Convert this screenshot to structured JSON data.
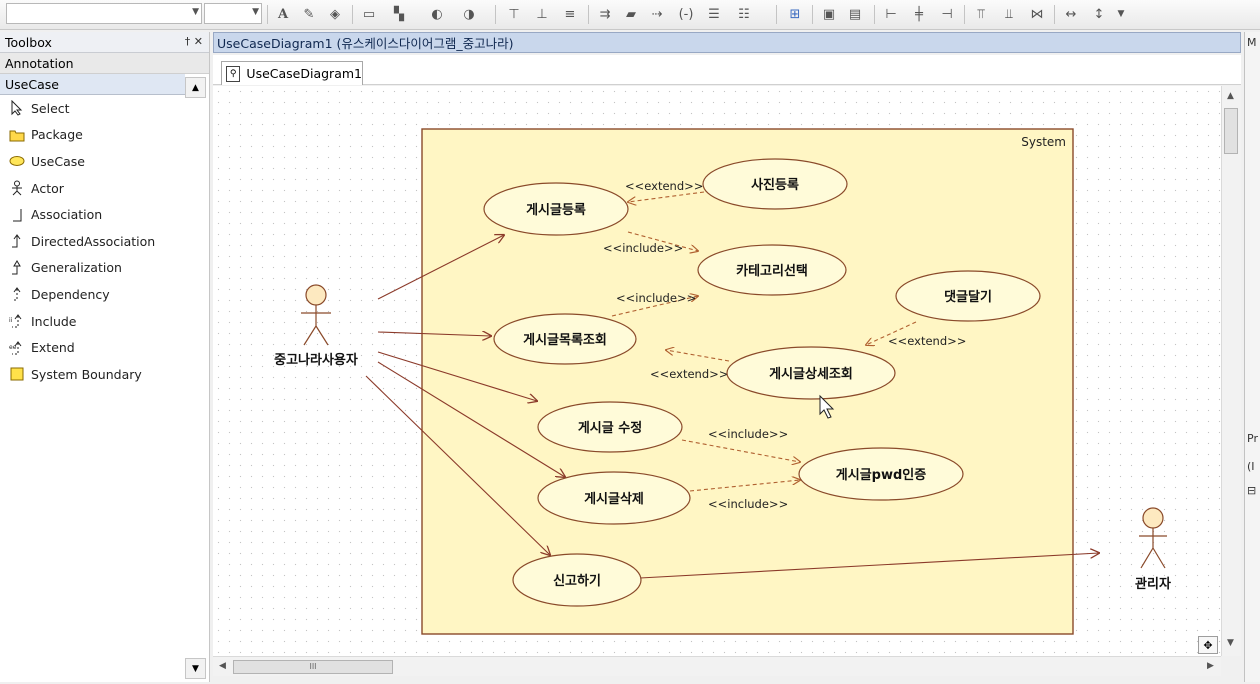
{
  "toolbox": {
    "title": "Toolbox",
    "header_icons": "† ✕",
    "sections": [
      "Annotation",
      "UseCase"
    ],
    "items": [
      {
        "label": "Select",
        "icon": "pointer-icon"
      },
      {
        "label": "Package",
        "icon": "folder-icon"
      },
      {
        "label": "UseCase",
        "icon": "ellipse-icon"
      },
      {
        "label": "Actor",
        "icon": "actor-icon"
      },
      {
        "label": "Association",
        "icon": "association-icon"
      },
      {
        "label": "DirectedAssociation",
        "icon": "directed-association-icon"
      },
      {
        "label": "Generalization",
        "icon": "generalization-icon"
      },
      {
        "label": "Dependency",
        "icon": "dependency-icon"
      },
      {
        "label": "Include",
        "icon": "include-icon"
      },
      {
        "label": "Extend",
        "icon": "extend-icon"
      },
      {
        "label": "System Boundary",
        "icon": "system-boundary-icon"
      }
    ]
  },
  "document": {
    "title": "UseCaseDiagram1 (유스케이스다이어그램_중고나라)",
    "tab_label": "UseCaseDiagram1",
    "scroll_thumb_label": "III"
  },
  "right_panel": {
    "top_label": "M",
    "labels": [
      "Pr",
      "(I",
      "⊟"
    ]
  },
  "diagram": {
    "system_label": "System",
    "use_cases": {
      "post_register": "게시글등록",
      "photo_register": "사진등록",
      "category_select": "카테고리선택",
      "comment": "댓글달기",
      "post_list": "게시글목록조회",
      "post_detail": "게시글상세조회",
      "post_edit": "게시글 수정",
      "post_delete": "게시글삭제",
      "pwd_auth": "게시글pwd인증",
      "report": "신고하기"
    },
    "actors": {
      "user": "중고나라사용자",
      "admin": "관리자"
    },
    "stereotypes": {
      "extend": "<<extend>>",
      "include": "<<include>>"
    }
  },
  "colors": {
    "system_fill": "#fff6c4",
    "system_border": "#8a4a2a",
    "usecase_fill": "#fffbd9",
    "line": "#8b3a2a",
    "dashed": "#b06030",
    "actor_head": "#fde9c0"
  }
}
